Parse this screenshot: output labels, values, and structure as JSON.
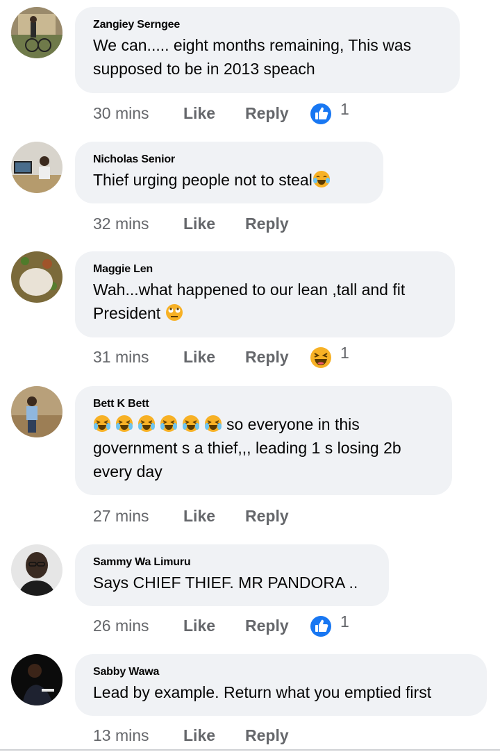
{
  "comments": [
    {
      "author": "Zangiey Serngee",
      "text": "We can..... eight months remaining, This was supposed to be in 2013 speach",
      "time": "30 mins",
      "like_label": "Like",
      "reply_label": "Reply",
      "reaction_icon": "like-icon",
      "reaction_count": "1"
    },
    {
      "author": "Nicholas Senior",
      "text": "Thief urging people not to steal",
      "emoji": "laughing-tears-emoji",
      "time": "32 mins",
      "like_label": "Like",
      "reply_label": "Reply"
    },
    {
      "author": "Maggie Len",
      "text_line1": "Wah...what happened to our lean ,tall and fit",
      "text_line2": "President",
      "emoji": "rolling-eyes-emoji",
      "time": "31 mins",
      "like_label": "Like",
      "reply_label": "Reply",
      "reaction_icon": "haha-icon",
      "reaction_count": "1"
    },
    {
      "author": "Bett K Bett",
      "emoji": "crying-laughing-emoji",
      "emoji_count": 6,
      "text_tail": "so everyone in this",
      "text_rest": "government s a thief,,, leading 1 s losing 2b every day",
      "time": "27 mins",
      "like_label": "Like",
      "reply_label": "Reply"
    },
    {
      "author": "Sammy Wa Limuru",
      "text": "Says CHIEF THIEF. MR PANDORA ..",
      "time": "26 mins",
      "like_label": "Like",
      "reply_label": "Reply",
      "reaction_icon": "like-icon",
      "reaction_count": "1"
    },
    {
      "author": "Sabby Wawa",
      "text": "Lead by example. Return what you emptied first",
      "time": "13 mins",
      "like_label": "Like",
      "reply_label": "Reply"
    }
  ],
  "colors": {
    "bubble": "#f0f2f5",
    "meta_text": "#65676b",
    "like_blue": "#1877f2",
    "emoji_yellow": "#f7b125"
  }
}
